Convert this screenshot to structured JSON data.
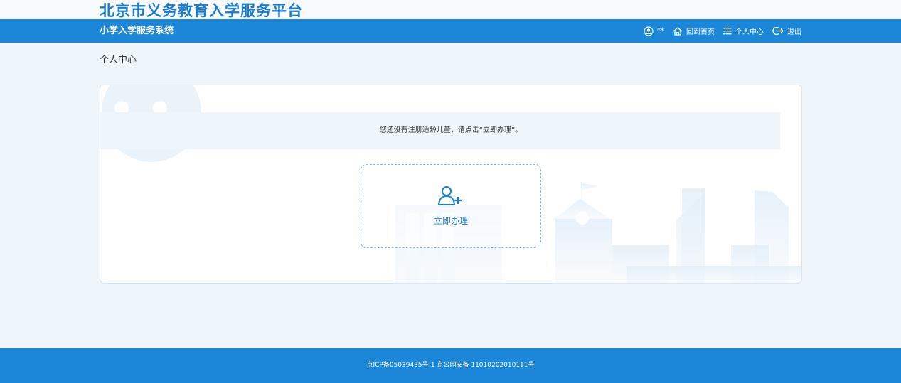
{
  "header": {
    "platform_title": "北京市义务教育入学服务平台",
    "system_title": "小学入学服务系统",
    "user_name": "**",
    "nav": {
      "home": "回到首页",
      "personal_center": "个人中心",
      "logout": "退出"
    }
  },
  "breadcrumb": "个人中心",
  "main": {
    "notice": "您还没有注册适龄儿童，请点击“立即办理”。",
    "action_label": "立即办理"
  },
  "footer": {
    "text": "京ICP备05039435号-1 京公网安备 11010202010111号"
  },
  "colors": {
    "primary": "#1c86d9",
    "title": "#1a79d0",
    "background": "#eef6fc"
  }
}
